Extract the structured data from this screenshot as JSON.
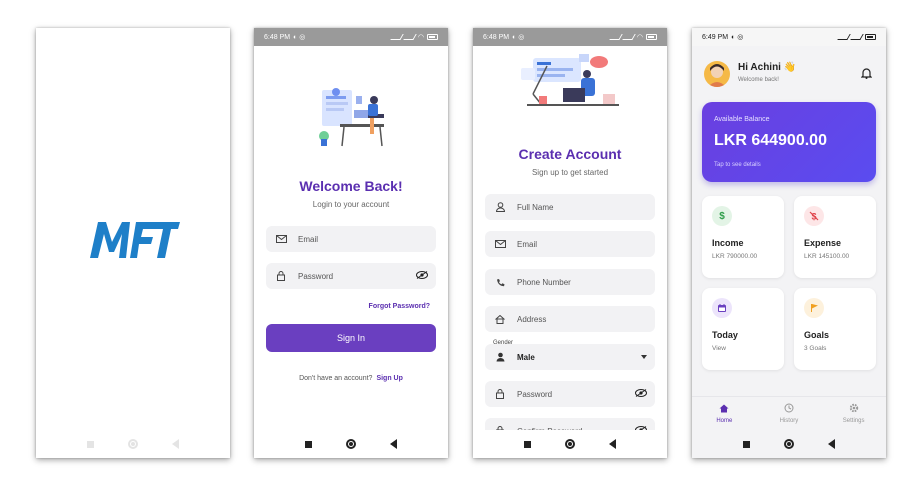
{
  "colors": {
    "accent": "#6a3fc0",
    "title_purple": "#5b2fb0",
    "logo_blue": "#1e7fc8"
  },
  "splash": {
    "logo_text": "MFT"
  },
  "login": {
    "status_time": "6:48 PM",
    "title": "Welcome Back!",
    "subtitle": "Login to your account",
    "email_placeholder": "Email",
    "password_placeholder": "Password",
    "forgot": "Forgot Password?",
    "sign_in": "Sign In",
    "no_account": "Don't have an account?",
    "sign_up": "Sign Up"
  },
  "register": {
    "status_time": "6:48 PM",
    "title": "Create Account",
    "subtitle": "Sign up to get started",
    "full_name": "Full Name",
    "email": "Email",
    "phone": "Phone Number",
    "address": "Address",
    "gender_label": "Gender",
    "gender_value": "Male",
    "password": "Password",
    "confirm_password": "Confirm Password"
  },
  "dashboard": {
    "status_time": "6:49 PM",
    "greeting": "Hi Achini 👋",
    "greeting_sub": "Welcome back!",
    "balance_label": "Available Balance",
    "balance_amount": "LKR 644900.00",
    "balance_hint": "Tap to see details",
    "cards": [
      {
        "title": "Income",
        "subtitle": "LKR 790000.00",
        "icon": "dollar-icon",
        "color": "#2e9e4a"
      },
      {
        "title": "Expense",
        "subtitle": "LKR 145100.00",
        "icon": "dollar-off-icon",
        "color": "#e0434b"
      },
      {
        "title": "Today",
        "subtitle": "View",
        "icon": "calendar-icon",
        "color": "#6a3fc0"
      },
      {
        "title": "Goals",
        "subtitle": "3 Goals",
        "icon": "flag-icon",
        "color": "#f0a020"
      }
    ],
    "nav": [
      {
        "label": "Home",
        "icon": "home-icon"
      },
      {
        "label": "History",
        "icon": "history-icon"
      },
      {
        "label": "Settings",
        "icon": "gear-icon"
      }
    ]
  }
}
